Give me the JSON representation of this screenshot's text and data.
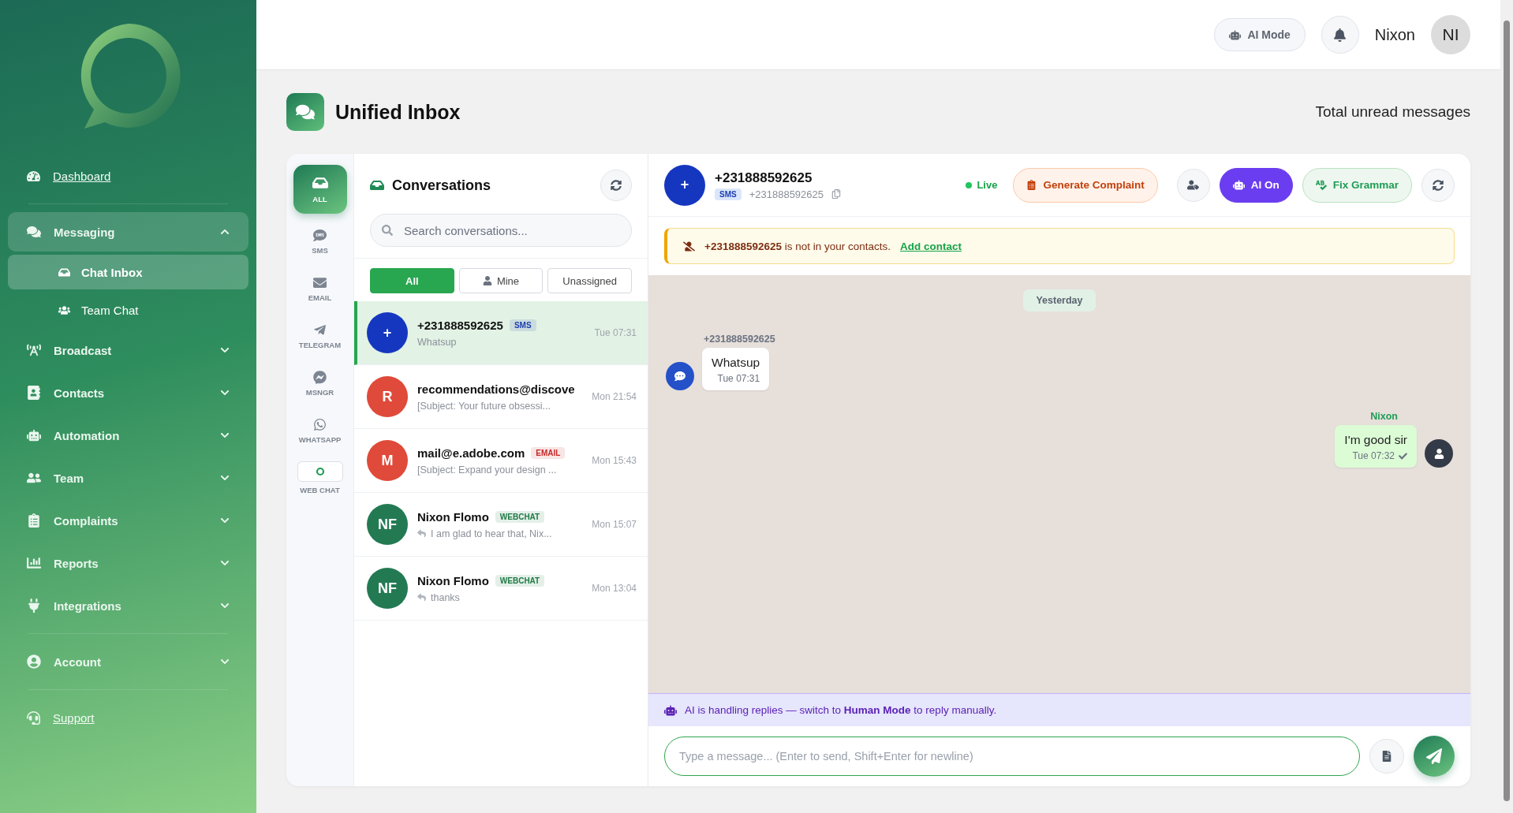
{
  "sidebar": {
    "sections": [
      [
        {
          "kind": "link",
          "label": "Dashboard"
        }
      ],
      [
        {
          "kind": "group",
          "label": "Messaging",
          "expanded": true,
          "children": [
            {
              "label": "Chat Inbox",
              "selected": true
            },
            {
              "label": "Team Chat",
              "selected": false
            }
          ]
        },
        {
          "kind": "group",
          "label": "Broadcast",
          "expanded": false
        },
        {
          "kind": "group",
          "label": "Contacts",
          "expanded": false
        },
        {
          "kind": "group",
          "label": "Automation",
          "expanded": false
        },
        {
          "kind": "group",
          "label": "Team",
          "expanded": false
        },
        {
          "kind": "group",
          "label": "Complaints",
          "expanded": false
        },
        {
          "kind": "group",
          "label": "Reports",
          "expanded": false
        },
        {
          "kind": "group",
          "label": "Integrations",
          "expanded": false
        }
      ],
      [
        {
          "kind": "group",
          "label": "Account",
          "expanded": false
        }
      ],
      [
        {
          "kind": "link",
          "label": "Support"
        }
      ]
    ]
  },
  "topbar": {
    "ai_mode": "AI Mode",
    "user_name": "Nixon",
    "avatar_initials": "NI"
  },
  "page": {
    "title": "Unified Inbox",
    "unread_label": "Total unread messages"
  },
  "channels": [
    {
      "label": "ALL",
      "selected": true
    },
    {
      "label": "SMS",
      "selected": false
    },
    {
      "label": "EMAIL",
      "selected": false
    },
    {
      "label": "TELEGRAM",
      "selected": false
    },
    {
      "label": "MSNGR",
      "selected": false
    },
    {
      "label": "WHATSAPP",
      "selected": false
    },
    {
      "label": "WEB CHAT",
      "selected": false
    }
  ],
  "conversations": {
    "title": "Conversations",
    "search_placeholder": "Search conversations...",
    "filters": [
      {
        "label": "All",
        "selected": true
      },
      {
        "label": "Mine",
        "selected": false
      },
      {
        "label": "Unassigned",
        "selected": false
      }
    ],
    "items": [
      {
        "avatar": "+",
        "color": "#1537c0",
        "name": "+231888592625",
        "tag": {
          "label": "SMS",
          "color": "#1e40af"
        },
        "preview": "Whatsup",
        "replied": false,
        "time": "Tue 07:31",
        "selected": true
      },
      {
        "avatar": "R",
        "color": "#e04a3a",
        "name": "recommendations@discove",
        "preview": "[Subject: Your future obsessi...",
        "replied": false,
        "time": "Mon 21:54",
        "selected": false
      },
      {
        "avatar": "M",
        "color": "#e04a3a",
        "name": "mail@e.adobe.com",
        "tag": {
          "label": "EMAIL",
          "color": "#c62828"
        },
        "preview": "[Subject: Expand your design ...",
        "replied": false,
        "time": "Mon 15:43",
        "selected": false
      },
      {
        "avatar": "NF",
        "color": "#237a52",
        "name": "Nixon Flomo",
        "tag": {
          "label": "WEBCHAT",
          "color": "#1f7a45"
        },
        "preview": "I am glad to hear that, Nix...",
        "replied": true,
        "time": "Mon 15:07",
        "selected": false
      },
      {
        "avatar": "NF",
        "color": "#237a52",
        "name": "Nixon Flomo",
        "tag": {
          "label": "WEBCHAT",
          "color": "#1f7a45"
        },
        "preview": "thanks",
        "replied": true,
        "time": "Mon 13:04",
        "selected": false
      }
    ]
  },
  "chat": {
    "avatar": "+",
    "name": "+231888592625",
    "channel_tag": "SMS",
    "phone": "+231888592625",
    "status": "Live",
    "generate_button": "Generate Complaint",
    "ai_toggle": {
      "label": "AI On",
      "on": true
    },
    "grammar_button": "Fix Grammar",
    "banner": {
      "text": "**+231888592625** is not in your contacts.",
      "link": "Add contact"
    },
    "messages": [
      {
        "kind": "date",
        "text": "Yesterday"
      },
      {
        "kind": "incoming",
        "sender": "+231888592625",
        "text": "Whatsup",
        "time": "Tue 07:31"
      },
      {
        "kind": "outgoing",
        "sender": "Nixon",
        "text": "I'm good sir",
        "time": "Tue 07:32",
        "delivered": true
      }
    ],
    "ai_notice": "AI is handling replies — switch to **Human Mode** to reply manually.",
    "composer_placeholder": "Type a message... (Enter to send, Shift+Enter for newline)"
  }
}
